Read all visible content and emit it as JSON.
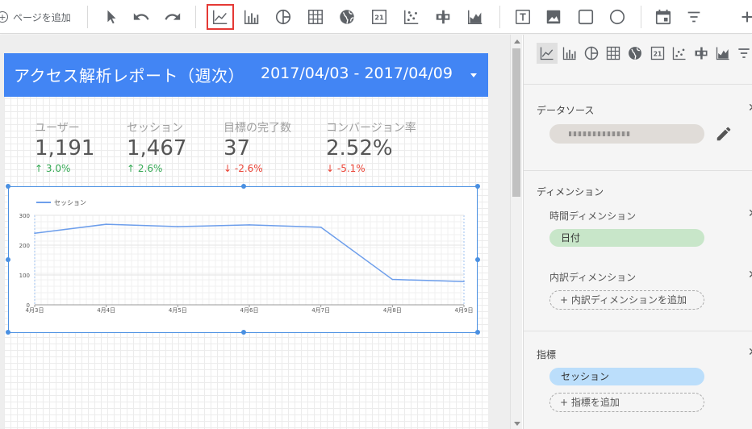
{
  "toolbar": {
    "add_page_label": "ページを追加",
    "tools": [
      {
        "name": "select-tool",
        "icon": "cursor-icon"
      },
      {
        "name": "undo",
        "icon": "undo-icon"
      },
      {
        "name": "redo",
        "icon": "redo-icon"
      },
      {
        "name": "time-series-chart",
        "icon": "line-chart-icon",
        "selected": true
      },
      {
        "name": "bar-chart",
        "icon": "bar-chart-icon"
      },
      {
        "name": "pie-chart",
        "icon": "pie-chart-icon"
      },
      {
        "name": "table",
        "icon": "table-icon"
      },
      {
        "name": "geo-map",
        "icon": "globe-icon"
      },
      {
        "name": "scorecard",
        "icon": "scorecard-icon",
        "text": "21"
      },
      {
        "name": "scatter-chart",
        "icon": "scatter-icon"
      },
      {
        "name": "bullet-chart",
        "icon": "bullet-icon"
      },
      {
        "name": "area-chart",
        "icon": "area-chart-icon"
      },
      {
        "name": "text",
        "icon": "text-icon",
        "text": "T"
      },
      {
        "name": "image",
        "icon": "image-icon"
      },
      {
        "name": "rectangle",
        "icon": "rectangle-icon"
      },
      {
        "name": "circle",
        "icon": "circle-icon"
      },
      {
        "name": "date-range",
        "icon": "calendar-icon"
      },
      {
        "name": "filter",
        "icon": "filter-icon"
      }
    ]
  },
  "report": {
    "title": "アクセス解析レポート（週次）",
    "date_range": "2017/04/03 - 2017/04/09",
    "accent_color": "#4285f4",
    "kpis": [
      {
        "label": "ユーザー",
        "value": "1,191",
        "delta": "3.0%",
        "direction": "up"
      },
      {
        "label": "セッション",
        "value": "1,467",
        "delta": "2.6%",
        "direction": "up"
      },
      {
        "label": "目標の完了数",
        "value": "37",
        "delta": "-2.6%",
        "direction": "down"
      },
      {
        "label": "コンバージョン率",
        "value": "2.52%",
        "delta": "-5.1%",
        "direction": "down"
      }
    ]
  },
  "chart_data": {
    "type": "line",
    "x": [
      "4月3日",
      "4月4日",
      "4月5日",
      "4月6日",
      "4月7日",
      "4月8日",
      "4月9日"
    ],
    "series": [
      {
        "name": "セッション",
        "values": [
          240,
          270,
          262,
          268,
          260,
          85,
          78
        ],
        "color": "#6d9eeb"
      }
    ],
    "yticks": [
      0,
      100,
      200,
      300
    ],
    "ylim": [
      0,
      300
    ],
    "grid": true,
    "legend": "top-left"
  },
  "panel": {
    "chart_types": [
      {
        "icon": "line-chart-icon",
        "active": true
      },
      {
        "icon": "bar-chart-icon"
      },
      {
        "icon": "pie-chart-icon"
      },
      {
        "icon": "table-icon"
      },
      {
        "icon": "globe-icon"
      },
      {
        "icon": "scorecard-icon",
        "text": "21"
      },
      {
        "icon": "scatter-icon"
      },
      {
        "icon": "bullet-icon"
      },
      {
        "icon": "area-chart-icon"
      },
      {
        "icon": "filter-icon"
      }
    ],
    "data_source_title": "データソース",
    "dimension_title": "ディメンション",
    "time_dimension_label": "時間ディメンション",
    "time_dimension_chip": "日付",
    "breakdown_dimension_label": "内訳ディメンション",
    "add_dimension_label": "+ 内訳ディメンションを追加",
    "metric_title": "指標",
    "metric_chip": "セッション",
    "add_metric_label": "+ 指標を追加",
    "dimension_chip_color": "#c8e6c9",
    "metric_chip_color": "#bbdefb"
  }
}
